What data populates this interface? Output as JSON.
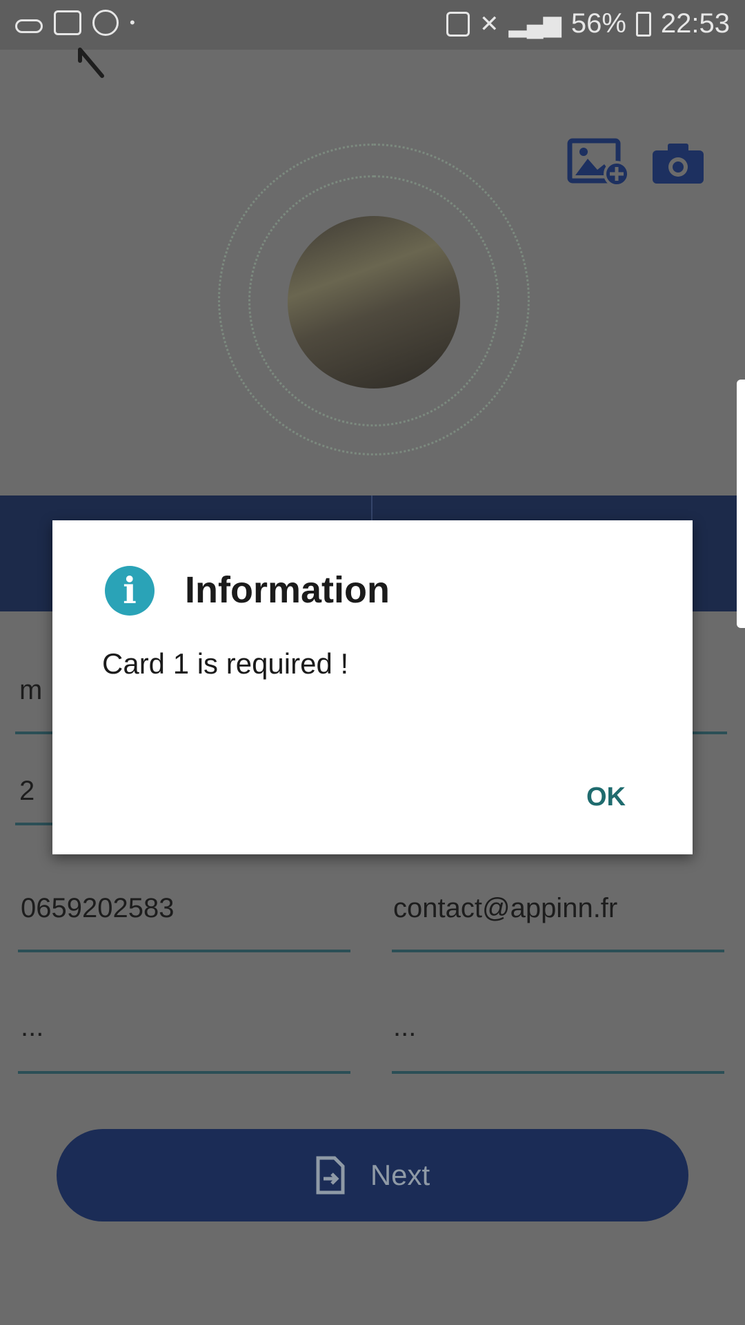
{
  "status_bar": {
    "battery": "56%",
    "time": "22:53"
  },
  "form": {
    "field_name_partial": "m",
    "field_number_partial": "2",
    "phone": "0659202583",
    "email": "contact@appinn.fr",
    "field_left_4": "...",
    "field_right_4": "..."
  },
  "next_button": {
    "label": "Next"
  },
  "dialog": {
    "title": "Information",
    "message": "Card 1 is required !",
    "ok_label": "OK"
  },
  "colors": {
    "accent_teal": "#2aa3b7",
    "primary_navy": "#1b2c56",
    "field_underline": "#2b4f56"
  },
  "icons": [
    "back-icon",
    "gallery-add-icon",
    "camera-icon",
    "info-icon",
    "document-icon"
  ]
}
